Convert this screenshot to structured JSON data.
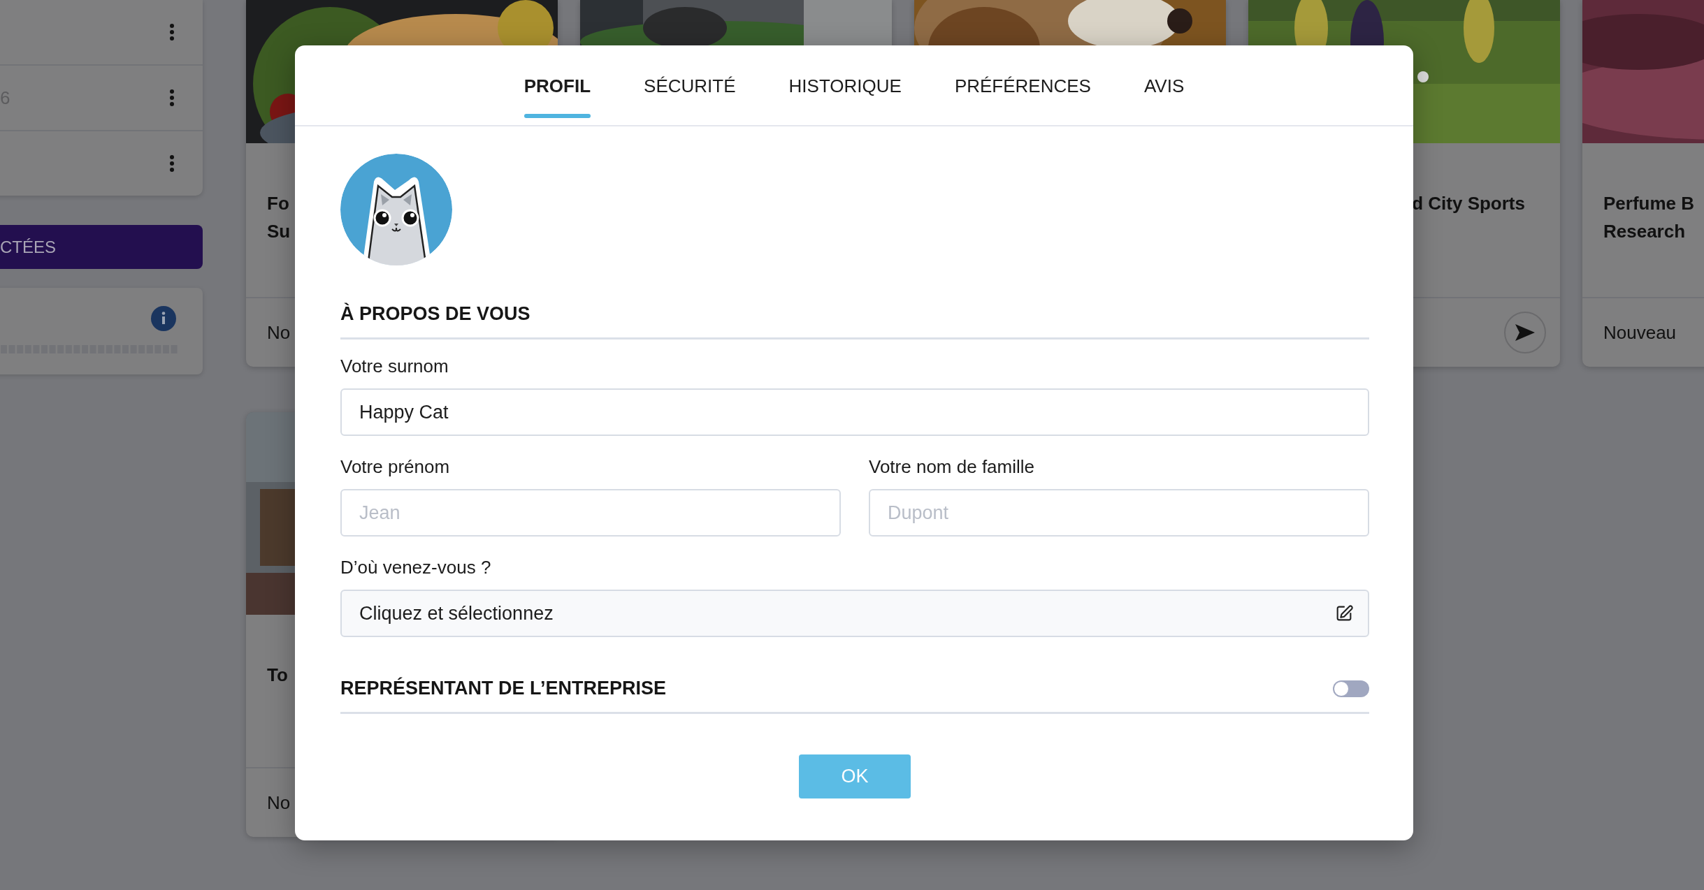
{
  "sidebar": {
    "list_rows": [
      {
        "kind": "blank"
      },
      {
        "kind": "value",
        "text": "6"
      },
      {
        "kind": "blank"
      }
    ],
    "action_button": {
      "label": "CTÉES"
    }
  },
  "cards": [
    {
      "kind": "full",
      "title_lines": [
        "Fo",
        "Su"
      ],
      "footer": {
        "kind": "text",
        "text": "No"
      }
    },
    {
      "kind": "picture"
    },
    {
      "kind": "picture"
    },
    {
      "kind": "full",
      "title_lines": [
        "d City Sports"
      ],
      "footer": {
        "kind": "send"
      }
    },
    {
      "kind": "full",
      "title_lines": [
        "Perfume B",
        "Research"
      ],
      "footer": {
        "kind": "text",
        "text": "Nouveau"
      }
    },
    {
      "kind": "full",
      "title_lines": [
        "To"
      ],
      "footer": {
        "kind": "text",
        "text": "No"
      }
    }
  ],
  "dialog": {
    "tabs": [
      {
        "label": "PROFIL",
        "selected": true
      },
      {
        "label": "SÉCURITÉ",
        "selected": false
      },
      {
        "label": "HISTORIQUE",
        "selected": false
      },
      {
        "label": "PRÉFÉRENCES",
        "selected": false
      },
      {
        "label": "AVIS",
        "selected": false
      }
    ],
    "section_title": "À PROPOS DE VOUS",
    "field_rows": [
      [
        {
          "kind": "text",
          "label": "Votre surnom",
          "value": "Happy Cat"
        }
      ],
      [
        {
          "kind": "text",
          "label": "Votre prénom",
          "placeholder": "Jean"
        },
        {
          "kind": "text",
          "label": "Votre nom de famille",
          "placeholder": "Dupont"
        }
      ],
      [
        {
          "kind": "select",
          "label": "D’où venez-vous ?",
          "value": "Cliquez et sélectionnez"
        }
      ]
    ],
    "toggle": {
      "label": "REPRÉSENTANT DE L’ENTREPRISE",
      "on": false
    },
    "ok_button": "OK"
  }
}
